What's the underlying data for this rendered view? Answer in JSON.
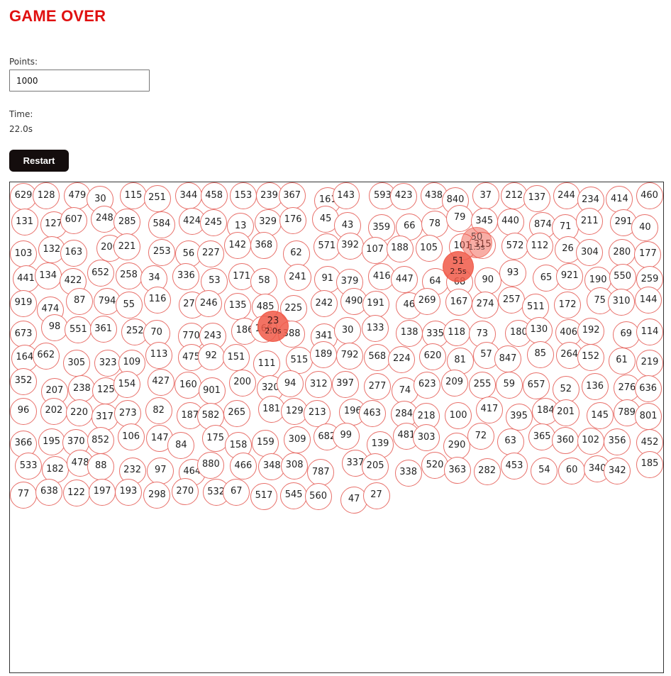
{
  "game": {
    "status": "GAME OVER",
    "points_label": "Points:",
    "points_value": "1000",
    "time_label": "Time:",
    "time_value": "22.0s",
    "restart_label": "Restart",
    "colors": {
      "status": "#e01010",
      "circle_border": "#e8706a",
      "fading": "#f05a48",
      "button": "#140d0d"
    },
    "circles": [
      {
        "n": "629"
      },
      {
        "n": "128"
      },
      {
        "n": "479"
      },
      {
        "n": "30"
      },
      {
        "n": "115"
      },
      {
        "n": "251"
      },
      {
        "n": "344"
      },
      {
        "n": "458"
      },
      {
        "n": "153"
      },
      {
        "n": "239"
      },
      {
        "n": "367"
      },
      {
        "n": "161"
      },
      {
        "n": "143"
      },
      {
        "n": "593"
      },
      {
        "n": "423"
      },
      {
        "n": "438"
      },
      {
        "n": "840"
      },
      {
        "n": "37"
      },
      {
        "n": "212"
      },
      {
        "n": "137"
      },
      {
        "n": "244"
      },
      {
        "n": "234"
      },
      {
        "n": "414"
      },
      {
        "n": "460"
      },
      {
        "n": "131"
      },
      {
        "n": "127"
      },
      {
        "n": "607"
      },
      {
        "n": "248"
      },
      {
        "n": "285"
      },
      {
        "n": "584"
      },
      {
        "n": "424"
      },
      {
        "n": "245"
      },
      {
        "n": "13"
      },
      {
        "n": "329"
      },
      {
        "n": "176"
      },
      {
        "n": "45"
      },
      {
        "n": "43"
      },
      {
        "n": "359"
      },
      {
        "n": "66"
      },
      {
        "n": "78"
      },
      {
        "n": "79"
      },
      {
        "n": "345"
      },
      {
        "n": "440"
      },
      {
        "n": "874"
      },
      {
        "n": "71"
      },
      {
        "n": "211"
      },
      {
        "n": "291"
      },
      {
        "n": "40"
      },
      {
        "n": "103"
      },
      {
        "n": "132"
      },
      {
        "n": "163"
      },
      {
        "n": "206"
      },
      {
        "n": "221"
      },
      {
        "n": "253"
      },
      {
        "n": "56"
      },
      {
        "n": "227"
      },
      {
        "n": "142"
      },
      {
        "n": "368"
      },
      {
        "n": "62"
      },
      {
        "n": "571"
      },
      {
        "n": "392"
      },
      {
        "n": "107"
      },
      {
        "n": "188"
      },
      {
        "n": "105"
      },
      {
        "n": "101"
      },
      {
        "n": "315"
      },
      {
        "n": "572"
      },
      {
        "n": "112"
      },
      {
        "n": "26"
      },
      {
        "n": "304"
      },
      {
        "n": "280"
      },
      {
        "n": "177"
      },
      {
        "n": "441"
      },
      {
        "n": "134"
      },
      {
        "n": "422"
      },
      {
        "n": "652"
      },
      {
        "n": "258"
      },
      {
        "n": "34"
      },
      {
        "n": "336"
      },
      {
        "n": "53"
      },
      {
        "n": "171"
      },
      {
        "n": "58"
      },
      {
        "n": "241"
      },
      {
        "n": "91"
      },
      {
        "n": "379"
      },
      {
        "n": "416"
      },
      {
        "n": "447"
      },
      {
        "n": "64"
      },
      {
        "n": "68"
      },
      {
        "n": "90"
      },
      {
        "n": "93"
      },
      {
        "n": "65"
      },
      {
        "n": "921"
      },
      {
        "n": "190"
      },
      {
        "n": "550"
      },
      {
        "n": "259"
      },
      {
        "n": "919"
      },
      {
        "n": "474"
      },
      {
        "n": "87"
      },
      {
        "n": "794"
      },
      {
        "n": "55"
      },
      {
        "n": "116"
      },
      {
        "n": "271"
      },
      {
        "n": "246"
      },
      {
        "n": "135"
      },
      {
        "n": "485"
      },
      {
        "n": "225"
      },
      {
        "n": "242"
      },
      {
        "n": "490"
      },
      {
        "n": "191"
      },
      {
        "n": "46"
      },
      {
        "n": "269"
      },
      {
        "n": "167"
      },
      {
        "n": "274"
      },
      {
        "n": "257"
      },
      {
        "n": "511"
      },
      {
        "n": "172"
      },
      {
        "n": "75"
      },
      {
        "n": "310"
      },
      {
        "n": "144"
      },
      {
        "n": "673"
      },
      {
        "n": "98"
      },
      {
        "n": "551"
      },
      {
        "n": "361"
      },
      {
        "n": "252"
      },
      {
        "n": "70"
      },
      {
        "n": "770"
      },
      {
        "n": "243"
      },
      {
        "n": "186"
      },
      {
        "n": "166"
      },
      {
        "n": "388"
      },
      {
        "n": "341"
      },
      {
        "n": "30"
      },
      {
        "n": "133"
      },
      {
        "n": "138"
      },
      {
        "n": "335"
      },
      {
        "n": "118"
      },
      {
        "n": "73"
      },
      {
        "n": "180"
      },
      {
        "n": "130"
      },
      {
        "n": "406"
      },
      {
        "n": "192"
      },
      {
        "n": "69"
      },
      {
        "n": "114"
      },
      {
        "n": "164"
      },
      {
        "n": "662"
      },
      {
        "n": "305"
      },
      {
        "n": "323"
      },
      {
        "n": "109"
      },
      {
        "n": "113"
      },
      {
        "n": "475"
      },
      {
        "n": "92"
      },
      {
        "n": "151"
      },
      {
        "n": "111"
      },
      {
        "n": "515"
      },
      {
        "n": "189"
      },
      {
        "n": "792"
      },
      {
        "n": "568"
      },
      {
        "n": "224"
      },
      {
        "n": "620"
      },
      {
        "n": "81"
      },
      {
        "n": "57"
      },
      {
        "n": "847"
      },
      {
        "n": "85"
      },
      {
        "n": "264"
      },
      {
        "n": "152"
      },
      {
        "n": "61"
      },
      {
        "n": "219"
      },
      {
        "n": "352"
      },
      {
        "n": "207"
      },
      {
        "n": "238"
      },
      {
        "n": "125"
      },
      {
        "n": "154"
      },
      {
        "n": "427"
      },
      {
        "n": "160"
      },
      {
        "n": "901"
      },
      {
        "n": "200"
      },
      {
        "n": "320"
      },
      {
        "n": "94"
      },
      {
        "n": "312"
      },
      {
        "n": "397"
      },
      {
        "n": "277"
      },
      {
        "n": "74"
      },
      {
        "n": "623"
      },
      {
        "n": "209"
      },
      {
        "n": "255"
      },
      {
        "n": "59"
      },
      {
        "n": "657"
      },
      {
        "n": "52"
      },
      {
        "n": "136"
      },
      {
        "n": "276"
      },
      {
        "n": "636"
      },
      {
        "n": "96"
      },
      {
        "n": "202"
      },
      {
        "n": "220"
      },
      {
        "n": "317"
      },
      {
        "n": "273"
      },
      {
        "n": "82"
      },
      {
        "n": "187"
      },
      {
        "n": "582"
      },
      {
        "n": "265"
      },
      {
        "n": "181"
      },
      {
        "n": "129"
      },
      {
        "n": "213"
      },
      {
        "n": "196"
      },
      {
        "n": "463"
      },
      {
        "n": "284"
      },
      {
        "n": "218"
      },
      {
        "n": "100"
      },
      {
        "n": "417"
      },
      {
        "n": "395"
      },
      {
        "n": "184"
      },
      {
        "n": "201"
      },
      {
        "n": "145"
      },
      {
        "n": "789"
      },
      {
        "n": "801"
      },
      {
        "n": "366"
      },
      {
        "n": "195"
      },
      {
        "n": "370"
      },
      {
        "n": "852"
      },
      {
        "n": "106"
      },
      {
        "n": "147"
      },
      {
        "n": "84"
      },
      {
        "n": "175"
      },
      {
        "n": "158"
      },
      {
        "n": "159"
      },
      {
        "n": "309"
      },
      {
        "n": "682"
      },
      {
        "n": "99"
      },
      {
        "n": "139"
      },
      {
        "n": "481"
      },
      {
        "n": "303"
      },
      {
        "n": "290"
      },
      {
        "n": "72"
      },
      {
        "n": "63"
      },
      {
        "n": "365"
      },
      {
        "n": "360"
      },
      {
        "n": "102"
      },
      {
        "n": "356"
      },
      {
        "n": "452"
      },
      {
        "n": "533"
      },
      {
        "n": "182"
      },
      {
        "n": "478"
      },
      {
        "n": "88"
      },
      {
        "n": "232"
      },
      {
        "n": "97"
      },
      {
        "n": "464"
      },
      {
        "n": "880"
      },
      {
        "n": "466"
      },
      {
        "n": "348"
      },
      {
        "n": "308"
      },
      {
        "n": "787"
      },
      {
        "n": "337"
      },
      {
        "n": "205"
      },
      {
        "n": "338"
      },
      {
        "n": "520"
      },
      {
        "n": "363"
      },
      {
        "n": "282"
      },
      {
        "n": "453"
      },
      {
        "n": "54"
      },
      {
        "n": "60"
      },
      {
        "n": "340"
      },
      {
        "n": "342"
      },
      {
        "n": "185"
      },
      {
        "n": "77"
      },
      {
        "n": "638"
      },
      {
        "n": "122"
      },
      {
        "n": "197"
      },
      {
        "n": "193"
      },
      {
        "n": "298"
      },
      {
        "n": "270"
      },
      {
        "n": "532"
      },
      {
        "n": "67"
      },
      {
        "n": "517"
      },
      {
        "n": "545"
      },
      {
        "n": "560"
      },
      {
        "n": "47"
      },
      {
        "n": "27"
      }
    ],
    "fading_circles": [
      {
        "n": "50",
        "countdown": "1.5s"
      },
      {
        "n": "51",
        "countdown": "2.5s"
      },
      {
        "n": "23",
        "countdown": "2.0s"
      }
    ]
  }
}
